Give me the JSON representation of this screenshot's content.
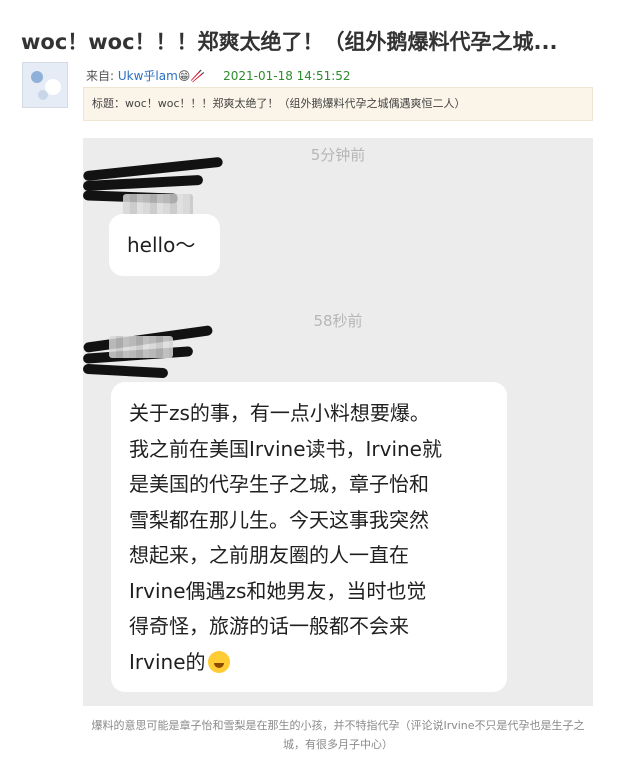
{
  "post": {
    "title": "woc！woc！！！郑爽太绝了！（组外鹅爆料代孕之城...",
    "from_label": "来自:",
    "author": "Ukw乎lam",
    "author_emoji": "😁🥢",
    "timestamp": "2021-01-18 14:51:52",
    "quote": "标题：woc！woc！！！郑爽太绝了！（组外鹅爆料代孕之城偶遇爽恒二人）"
  },
  "screenshot": {
    "time_1": "5分钟前",
    "message_1": "hello～",
    "time_2": "58秒前",
    "message_2_lines": [
      "关于zs的事，有一点小料想要爆。",
      "我之前在美国Irvine读书，Irvine就",
      "是美国的代孕生子之城，章子怡和",
      "雪梨都在那儿生。今天这事我突然",
      "起来，之前朋友圈的人一直在",
      "Irvine偶遇zs和她男友，当时也觉",
      "得奇怪，旅游的话一般都不会来",
      "Irvine的"
    ],
    "message_2_line5_prefix": "想"
  },
  "caption": "爆料的意思可能是章子怡和雪梨是在那生的小孩，并不特指代孕（评论说Irvine不只是代孕也是生子之城，有很多月子中心）"
}
